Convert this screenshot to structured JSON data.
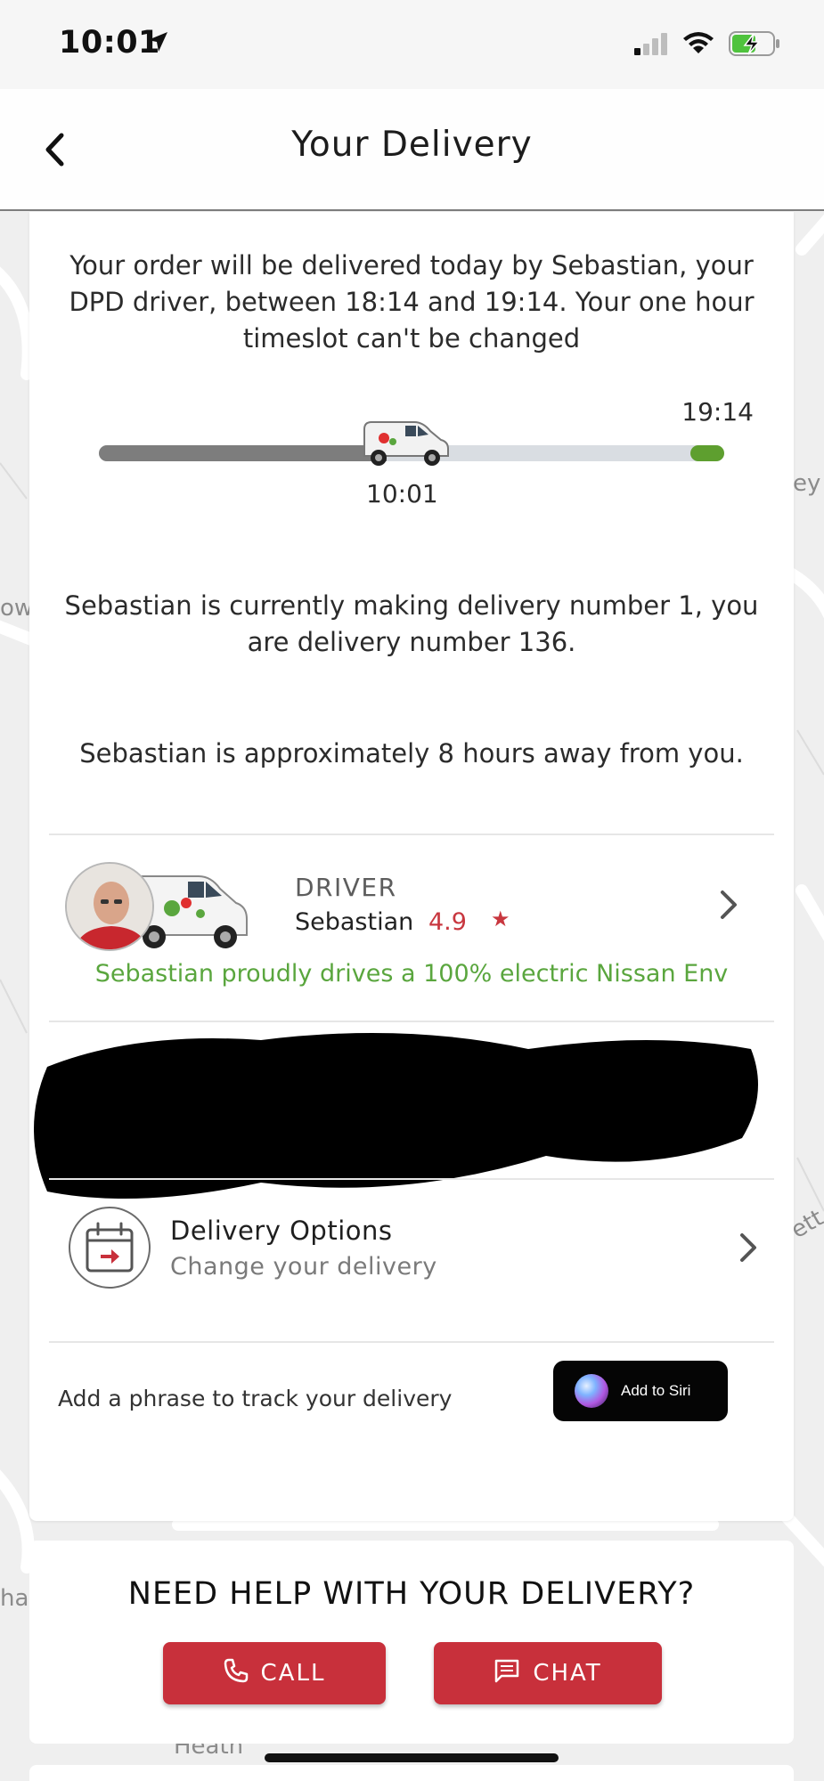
{
  "status_bar": {
    "time": "10:01",
    "icons": [
      "location-arrow-icon",
      "cellular-signal-icon",
      "wifi-icon",
      "battery-charging-icon"
    ]
  },
  "nav": {
    "title": "Your Delivery",
    "back_icon": "chevron-left-icon"
  },
  "map_labels": [
    "ey",
    "ow",
    "ett",
    "ha",
    "Heath"
  ],
  "delivery": {
    "intro": "Your  order will be delivered today by Sebastian, your DPD driver, between 18:14 and 19:14. Your one hour timeslot can't be changed",
    "slot_end": "19:14",
    "current_time": "10:01",
    "progress_fraction": 0.46,
    "delivery_number_text": "Sebastian is currently making delivery number 1, you are delivery number 136.",
    "eta_text": "Sebastian is approximately 8 hours away from you."
  },
  "driver": {
    "label": "DRIVER",
    "name": "Sebastian",
    "rating": "4.9",
    "star": "★",
    "note": "Sebastian proudly drives a 100% electric Nissan Env"
  },
  "options": {
    "title": "Delivery Options",
    "subtitle": "Change your delivery",
    "icon": "calendar-arrow-icon"
  },
  "siri": {
    "text": "Add a phrase to track your delivery",
    "button_label": "Add to Siri"
  },
  "help": {
    "title": "NEED HELP WITH YOUR DELIVERY?",
    "call_label": "CALL",
    "chat_label": "CHAT"
  },
  "colors": {
    "brand_red": "#c8303b",
    "electric_green": "#5aa63e",
    "rating_red": "#c8373f"
  }
}
